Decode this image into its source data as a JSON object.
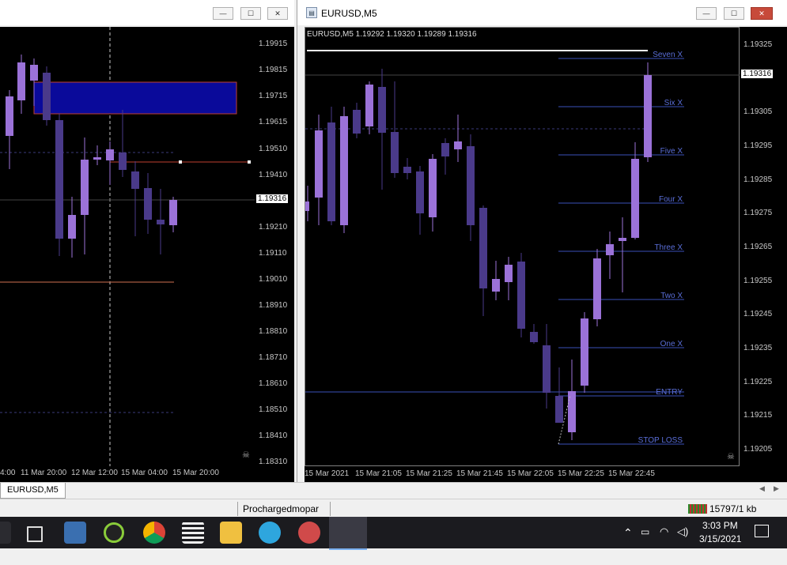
{
  "left_window": {
    "buttons": {
      "minimize": "—",
      "maximize": "☐",
      "close": "✕"
    },
    "price_labels": [
      "1.19915",
      "1.19815",
      "1.19715",
      "1.19615",
      "1.19510",
      "1.19410",
      "1.19316",
      "1.19210",
      "1.19110",
      "1.19010",
      "1.18910",
      "1.18810",
      "1.18710",
      "1.18610",
      "1.18510",
      "1.18410",
      "1.18310"
    ],
    "current_price": "1.19316",
    "time_labels": [
      "4:00",
      "11 Mar 20:00",
      "12 Mar 12:00",
      "15 Mar 04:00",
      "15 Mar 20:00"
    ]
  },
  "right_window": {
    "title": "EURUSD,M5",
    "buttons": {
      "minimize": "—",
      "maximize": "☐",
      "close": "✕"
    },
    "chart_header": "EURUSD,M5  1.19292 1.19320 1.19289 1.19316",
    "price_labels": [
      "1.19325",
      "1.19305",
      "1.19295",
      "1.19285",
      "1.19275",
      "1.19265",
      "1.19255",
      "1.19245",
      "1.19235",
      "1.19225",
      "1.19215",
      "1.19205"
    ],
    "current_price": "1.19316",
    "time_labels": [
      "15 Mar 2021",
      "15 Mar 21:05",
      "15 Mar 21:25",
      "15 Mar 21:45",
      "15 Mar 22:05",
      "15 Mar 22:25",
      "15 Mar 22:45"
    ],
    "levels": [
      "Seven X",
      "Six X",
      "Five X",
      "Four X",
      "Three X",
      "Two X",
      "One X",
      "ENTRY",
      "STOP LOSS"
    ]
  },
  "tabbar": {
    "active_tab": "EURUSD,M5"
  },
  "statusbar": {
    "profile": "Prochargedmopar",
    "connection": "15797/1 kb"
  },
  "taskbar": {
    "time": "3:03 PM",
    "date": "3/15/2021",
    "icons": [
      "windows-icon",
      "task-view-icon",
      "control-panel-icon",
      "app-n-icon",
      "chrome-icon",
      "calculator-icon",
      "file-explorer-icon",
      "telegram-icon",
      "snipping-icon",
      "metatrader-icon"
    ]
  },
  "colors": {
    "bull_candle": "#9b72d8",
    "bear_candle": "#4a3a8a",
    "level_line": "#3a4fb8",
    "level_text": "#5a6ed8",
    "zone_fill": "#0a0a9a",
    "zone_border": "#c04030"
  }
}
